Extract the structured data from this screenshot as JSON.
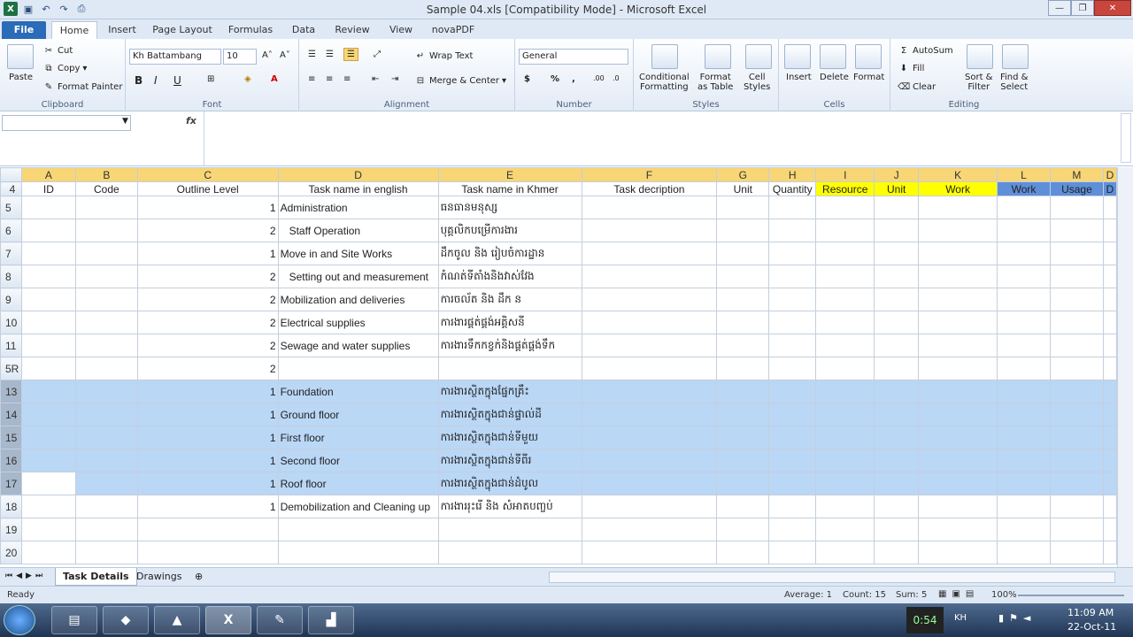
{
  "window": {
    "title": "Sample 04.xls  [Compatibility Mode]  -  Microsoft Excel"
  },
  "tabs": [
    "File",
    "Home",
    "Insert",
    "Page Layout",
    "Formulas",
    "Data",
    "Review",
    "View",
    "novaPDF"
  ],
  "ribbon": {
    "clipboard": {
      "label": "Clipboard",
      "paste": "Paste",
      "cut": "Cut",
      "copy": "Copy",
      "format_painter": "Format Painter"
    },
    "font": {
      "label": "Font",
      "name": "Kh Battambang",
      "size": "10"
    },
    "alignment": {
      "label": "Alignment",
      "wrap": "Wrap Text",
      "merge": "Merge & Center"
    },
    "number": {
      "label": "Number",
      "format": "General"
    },
    "styles": {
      "label": "Styles",
      "cond1": "Conditional",
      "cond2": "Formatting",
      "fmt1": "Format",
      "fmt2": "as Table",
      "cell1": "Cell",
      "cell2": "Styles"
    },
    "cells": {
      "label": "Cells",
      "insert": "Insert",
      "delete": "Delete",
      "format": "Format"
    },
    "editing": {
      "label": "Editing",
      "autosum": "AutoSum",
      "fill": "Fill",
      "clear": "Clear",
      "sort1": "Sort &",
      "sort2": "Filter",
      "find1": "Find &",
      "find2": "Select"
    }
  },
  "formula_bar": {
    "name_box": "",
    "fx": "fx",
    "content": ""
  },
  "columns": [
    "A",
    "B",
    "C",
    "D",
    "E",
    "F",
    "G",
    "H",
    "I",
    "J",
    "K",
    "L",
    "M",
    "D"
  ],
  "header_row": {
    "num": "4",
    "cells": [
      "ID",
      "Code",
      "Outline Level",
      "Task name in english",
      "Task name in Khmer",
      "Task decription",
      "Unit",
      "Quantity",
      "Resource",
      "Unit",
      "Work",
      "Work",
      "Usage",
      "D"
    ]
  },
  "rows": [
    {
      "num": "5",
      "level": "1",
      "en": "Administration",
      "km": "ធនធានមនុស្ស"
    },
    {
      "num": "6",
      "level": "2",
      "en": "   Staff Operation",
      "km": "   បុគ្គលិកបម្រើការងារ"
    },
    {
      "num": "7",
      "level": "1",
      "en": "Move in and Site Works",
      "km": "ដឹកចូល និង រៀបចំការដ្ឋាន"
    },
    {
      "num": "8",
      "level": "2",
      "en": "   Setting out and measurement",
      "km": "កំណត់ទីតាំងនិងវាស់វែង"
    },
    {
      "num": "9",
      "level": "2",
      "en": "Mobilization and deliveries",
      "km": "ការចល័ត និង ដឹក ន"
    },
    {
      "num": "10",
      "level": "2",
      "en": "Electrical supplies",
      "km": "ការងារផ្គត់ផ្គង់អគ្គិសនី"
    },
    {
      "num": "11",
      "level": "2",
      "en": "Sewage and water supplies",
      "km": "ការងារទឹកកខ្វក់និងផ្គត់ផ្គង់ទឹក"
    },
    {
      "num": "5R",
      "level": "2",
      "en": "",
      "km": ""
    },
    {
      "num": "13",
      "level": "1",
      "en": "Foundation",
      "km": "ការងារស្ថិតក្នុងផ្នែកគ្រឹះ"
    },
    {
      "num": "14",
      "level": "1",
      "en": "Ground floor",
      "km": "ការងារស្ថិតក្នុងជាន់ផ្ទាល់ដី"
    },
    {
      "num": "15",
      "level": "1",
      "en": "First floor",
      "km": "ការងារស្ថិតក្នុងជាន់ទីមួយ"
    },
    {
      "num": "16",
      "level": "1",
      "en": "Second floor",
      "km": "ការងារស្ថិតក្នុងជាន់ទីពីរ"
    },
    {
      "num": "17",
      "level": "1",
      "en": "Roof floor",
      "km": "ការងារស្ថិតក្នុងជាន់ដំបូល"
    },
    {
      "num": "18",
      "level": "1",
      "en": "Demobilization and Cleaning up",
      "km": "ការងាររុះរើ និង សំអាតបញ្ចប់"
    },
    {
      "num": "19",
      "level": "",
      "en": "",
      "km": ""
    },
    {
      "num": "20",
      "level": "",
      "en": "",
      "km": ""
    }
  ],
  "sheets": {
    "active": "Task Details",
    "other": "Drawings"
  },
  "status": {
    "ready": "Ready",
    "average": "Average: 1",
    "count": "Count: 15",
    "sum": "Sum: 5",
    "zoom": "100%"
  },
  "taskbar": {
    "timer": "0:54",
    "lang": "KH",
    "time": "11:09 AM",
    "date": "22-Oct-11"
  }
}
